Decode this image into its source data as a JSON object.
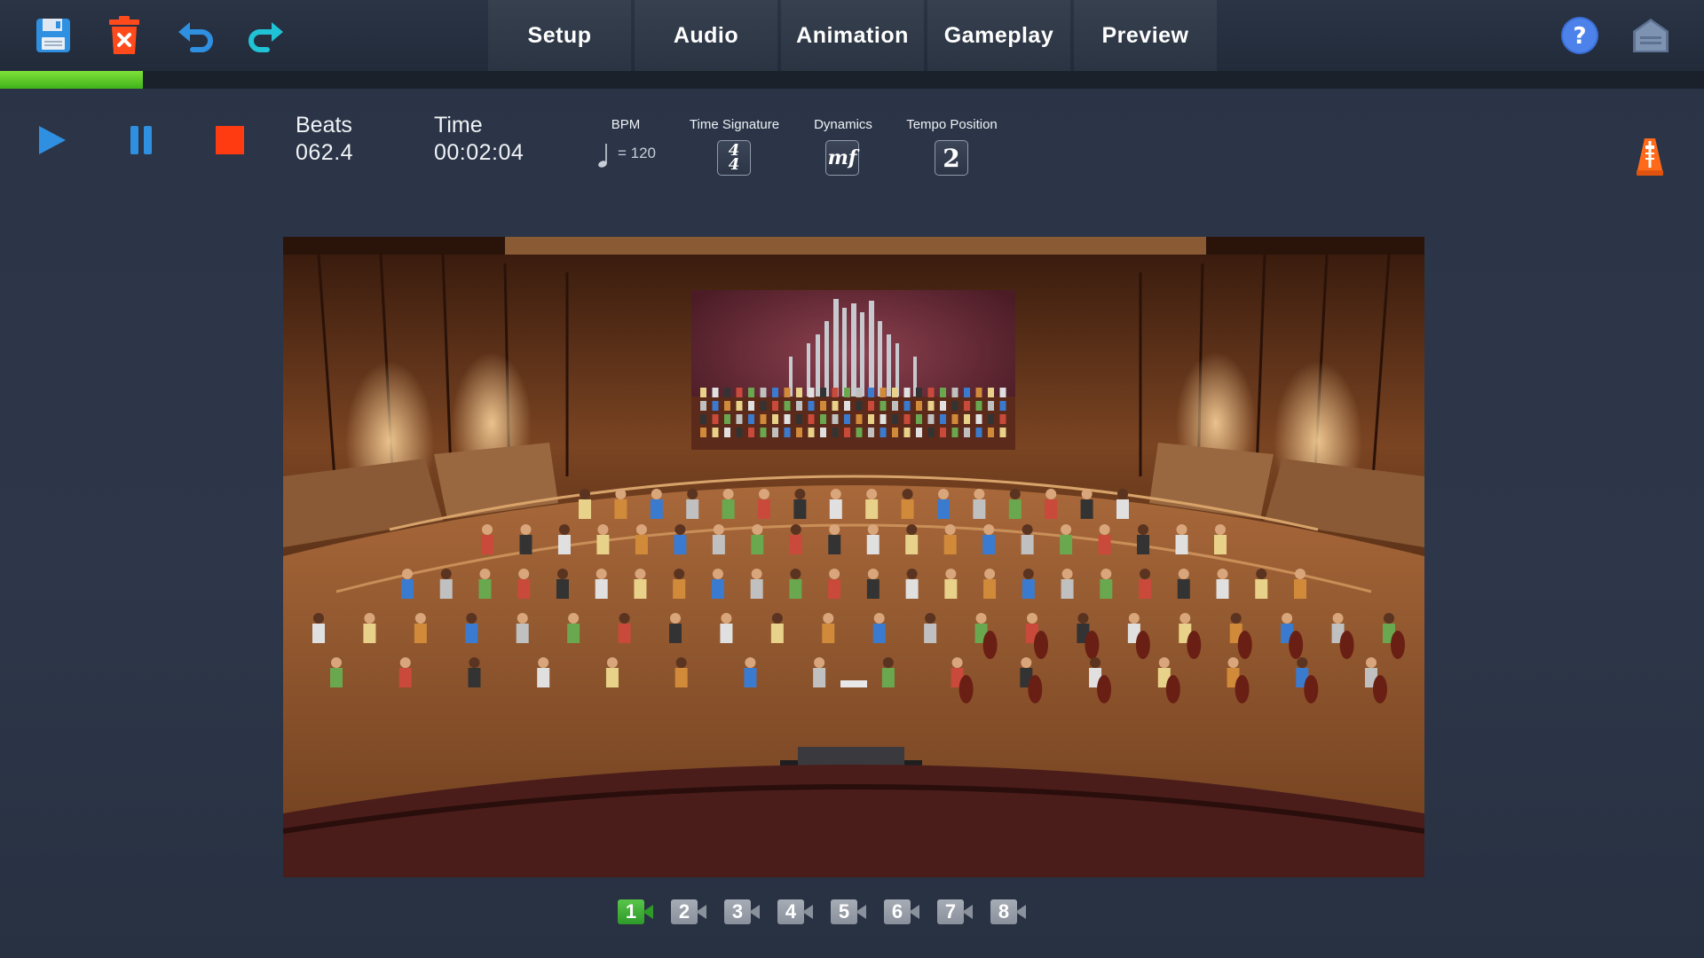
{
  "toolbar": {
    "save_icon": "floppy-disk-icon",
    "delete_icon": "trash-delete-icon",
    "undo_icon": "undo-arrow-icon",
    "redo_icon": "redo-arrow-icon",
    "help_icon": "question-mark-icon",
    "home_icon": "home-icon"
  },
  "tabs": [
    {
      "label": "Setup"
    },
    {
      "label": "Audio"
    },
    {
      "label": "Animation"
    },
    {
      "label": "Gameplay"
    },
    {
      "label": "Preview"
    }
  ],
  "progress": {
    "fraction": 0.084
  },
  "transport": {
    "play_icon": "play-icon",
    "pause_icon": "pause-icon",
    "stop_icon": "stop-icon",
    "beats_label": "Beats",
    "beats_value": "062.4",
    "time_label": "Time",
    "time_value": "00:02:04"
  },
  "params": {
    "bpm_label": "BPM",
    "bpm_value": "= 120",
    "time_signature_label": "Time Signature",
    "time_signature_top": "4",
    "time_signature_bottom": "4",
    "dynamics_label": "Dynamics",
    "dynamics_value": "mf",
    "tempo_position_label": "Tempo Position",
    "tempo_position_value": "2",
    "metronome_icon": "metronome-icon"
  },
  "colors": {
    "accent_blue": "#2f8fe0",
    "stop_red": "#ff3b12",
    "progress_green": "#4cc31f",
    "active_camera_green": "#3fae32"
  },
  "cameras": [
    {
      "label": "1",
      "active": true
    },
    {
      "label": "2",
      "active": false
    },
    {
      "label": "3",
      "active": false
    },
    {
      "label": "4",
      "active": false
    },
    {
      "label": "5",
      "active": false
    },
    {
      "label": "6",
      "active": false
    },
    {
      "label": "7",
      "active": false
    },
    {
      "label": "8",
      "active": false
    }
  ]
}
